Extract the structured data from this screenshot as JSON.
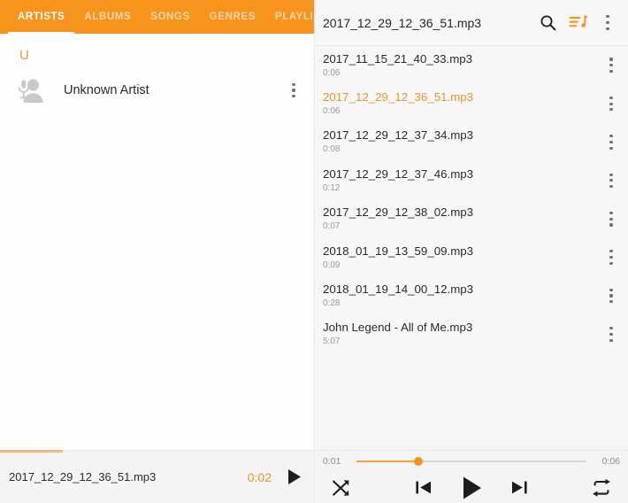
{
  "theme": {
    "accent": "#F7941D",
    "accent_text": "#F0922A",
    "accent_soft": "#F4B878",
    "text_primary": "#2a2a2a",
    "text_secondary": "#9a9a9a",
    "left_bg": "#fdfdfd",
    "right_bg": "#f7f7f7",
    "bottom_bg": "#f4f4f4"
  },
  "library": {
    "tabs": [
      {
        "label": "ARTISTS",
        "active": true
      },
      {
        "label": "ALBUMS",
        "active": false
      },
      {
        "label": "SONGS",
        "active": false
      },
      {
        "label": "GENRES",
        "active": false
      },
      {
        "label": "PLAYLISTS",
        "active": false
      }
    ],
    "section_letter": "U",
    "artists": [
      {
        "name": "Unknown Artist",
        "icon": "artist-microphone-icon"
      }
    ]
  },
  "queue": {
    "header": {
      "title": "2017_12_29_12_36_51.mp3",
      "search_icon": "search-icon",
      "queue_icon": "playlist-queue-icon",
      "overflow_icon": "more-vertical-icon"
    },
    "tracks": [
      {
        "title": "2017_11_15_21_40_33.mp3",
        "duration": "0:06",
        "playing": false
      },
      {
        "title": "2017_12_29_12_36_51.mp3",
        "duration": "0:06",
        "playing": true
      },
      {
        "title": "2017_12_29_12_37_34.mp3",
        "duration": "0:08",
        "playing": false
      },
      {
        "title": "2017_12_29_12_37_46.mp3",
        "duration": "0:12",
        "playing": false
      },
      {
        "title": "2017_12_29_12_38_02.mp3",
        "duration": "0:07",
        "playing": false
      },
      {
        "title": "2018_01_19_13_59_09.mp3",
        "duration": "0:09",
        "playing": false
      },
      {
        "title": "2018_01_19_14_00_12.mp3",
        "duration": "0:28",
        "playing": false
      },
      {
        "title": "John Legend - All of Me.mp3",
        "duration": "5:07",
        "playing": false
      }
    ]
  },
  "mini_player": {
    "title": "2017_12_29_12_36_51.mp3",
    "elapsed": "0:02",
    "play_icon": "play-icon",
    "progress_percent": 20
  },
  "player": {
    "elapsed": "0:01",
    "total": "0:06",
    "progress_percent": 27,
    "shuffle_icon": "shuffle-icon",
    "previous_icon": "skip-previous-icon",
    "play_icon": "play-icon",
    "next_icon": "skip-next-icon",
    "repeat_icon": "repeat-icon"
  }
}
